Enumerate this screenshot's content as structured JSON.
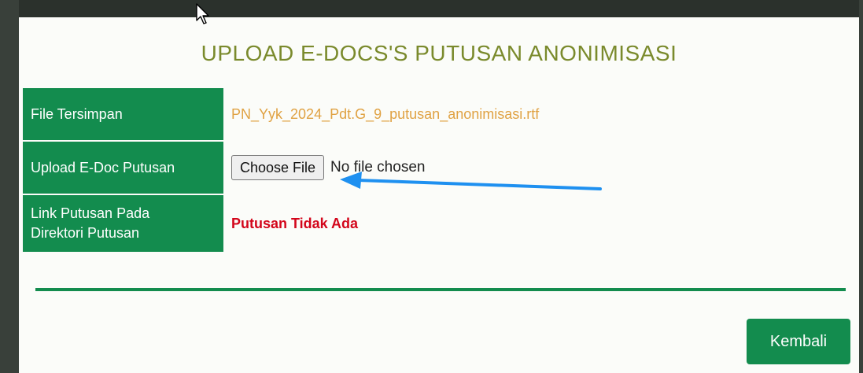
{
  "modal": {
    "title": "UPLOAD E-DOCS'S PUTUSAN ANONIMISASI"
  },
  "form": {
    "rows": [
      {
        "label": "File Tersimpan",
        "value": "PN_Yyk_2024_Pdt.G_9_putusan_anonimisasi.rtf"
      },
      {
        "label": "Upload E-Doc Putusan",
        "button": "Choose File",
        "status": "No file chosen"
      },
      {
        "label_line1": "Link Putusan Pada",
        "label_line2": "Direktori Putusan",
        "value": "Putusan Tidak Ada"
      }
    ]
  },
  "footer": {
    "back_label": "Kembali"
  },
  "colors": {
    "accent_green": "#138c4e",
    "title_olive": "#7a8a2c",
    "file_orange": "#e0a243",
    "error_red": "#d3061b",
    "annotation_arrow_blue": "#1e90f0"
  },
  "icons": {
    "cursor": "mouse-pointer-icon",
    "arrow": "annotation-arrow-icon"
  }
}
